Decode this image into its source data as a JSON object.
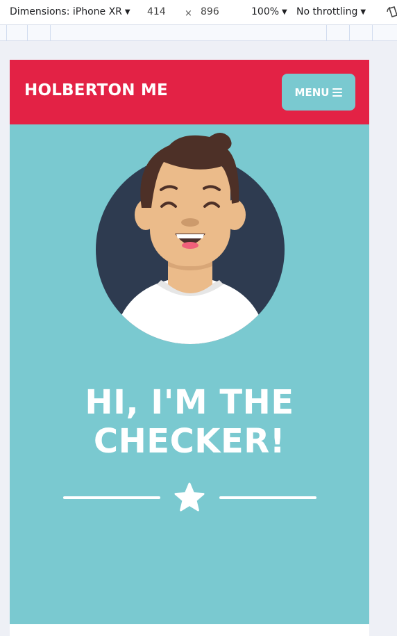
{
  "devtools": {
    "device_label": "Dimensions: iPhone XR",
    "width": "414",
    "times": "×",
    "height": "896",
    "zoom": "100%",
    "throttling": "No throttling",
    "icons": [
      "caret-down-icon",
      "rotate-icon"
    ]
  },
  "site": {
    "logo": "HOLBERTON ME",
    "menu_label": "MENU",
    "hero_title_line1": "HI, I'M THE",
    "hero_title_line2": "CHECKER!",
    "icons": [
      "hamburger-icon",
      "avatar-illustration",
      "star-icon"
    ]
  },
  "colors": {
    "header_red": "#e32245",
    "teal": "#7ac9d0",
    "avatar_bg": "#2e3b50",
    "hair": "#4d3027",
    "skin": "#ebbb8a",
    "white": "#ffffff"
  }
}
